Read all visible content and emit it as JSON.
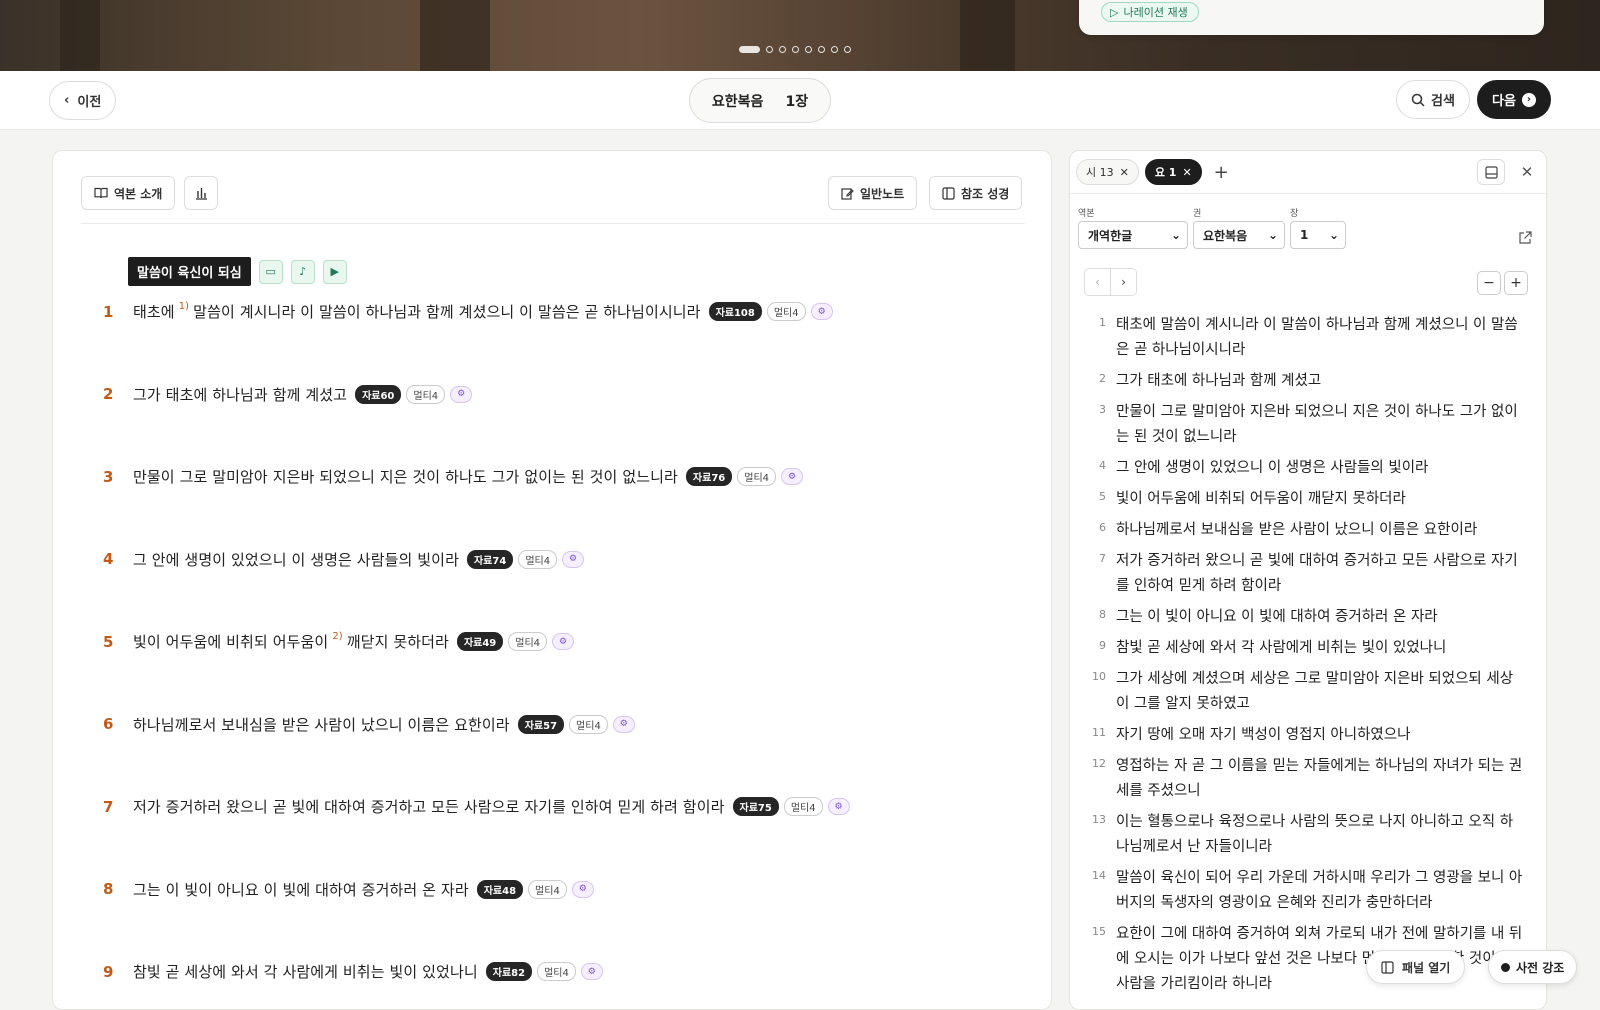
{
  "hero": {
    "narration_label": "나레이션 재생",
    "slides_total": 8,
    "slide_active": 1
  },
  "topbar": {
    "prev_label": "이전",
    "book": "요한복음",
    "chapter": "1장",
    "search_label": "검색",
    "next_label": "다음"
  },
  "toolbar": {
    "intro_label": "역본 소개",
    "note_label": "일반노트",
    "ref_label": "참조 성경"
  },
  "section": {
    "title": "말씀이 육신이 되심"
  },
  "verses": [
    {
      "num": "1",
      "pre": "태초에",
      "sup": "1)",
      "text": "말씀이 계시니라 이 말씀이 하나님과 함께 계셨으니 이 말씀은 곧 하나님이시니라",
      "tag": "자료108",
      "multi": "멀티4"
    },
    {
      "num": "2",
      "pre": "",
      "sup": "",
      "text": "그가 태초에 하나님과 함께 계셨고",
      "tag": "자료60",
      "multi": "멀티4"
    },
    {
      "num": "3",
      "pre": "",
      "sup": "",
      "text": "만물이 그로 말미암아 지은바 되었으니 지은 것이 하나도 그가 없이는 된 것이 없느니라",
      "tag": "자료76",
      "multi": "멀티4"
    },
    {
      "num": "4",
      "pre": "",
      "sup": "",
      "text": "그 안에 생명이 있었으니 이 생명은 사람들의 빛이라",
      "tag": "자료74",
      "multi": "멀티4"
    },
    {
      "num": "5",
      "pre": "빛이 어두움에 비취되 어두움이",
      "sup": "2)",
      "text": "깨닫지 못하더라",
      "tag": "자료49",
      "multi": "멀티4"
    },
    {
      "num": "6",
      "pre": "",
      "sup": "",
      "text": "하나님께로서 보내심을 받은 사람이 났으니 이름은 요한이라",
      "tag": "자료57",
      "multi": "멀티4"
    },
    {
      "num": "7",
      "pre": "",
      "sup": "",
      "text": "저가 증거하러 왔으니 곧 빛에 대하여 증거하고 모든 사람으로 자기를 인하여 믿게 하려 함이라",
      "tag": "자료75",
      "multi": "멀티4"
    },
    {
      "num": "8",
      "pre": "",
      "sup": "",
      "text": "그는 이 빛이 아니요 이 빛에 대하여 증거하러 온 자라",
      "tag": "자료48",
      "multi": "멀티4"
    },
    {
      "num": "9",
      "pre": "",
      "sup": "",
      "text": "참빛 곧 세상에 와서 각 사람에게 비취는 빛이 있었나니",
      "tag": "자료82",
      "multi": "멀티4"
    }
  ],
  "side": {
    "tabs": [
      {
        "label": "시 13"
      },
      {
        "label": "요 1"
      }
    ],
    "field_version_label": "역본",
    "field_book_label": "권",
    "field_chapter_label": "장",
    "version": "개역한글",
    "book": "요한복음",
    "chapter": "1",
    "verses": [
      {
        "n": "1",
        "t": "태초에 말씀이 계시니라 이 말씀이 하나님과 함께 계셨으니 이 말씀은 곧 하나님이시니라"
      },
      {
        "n": "2",
        "t": "그가 태초에 하나님과 함께 계셨고"
      },
      {
        "n": "3",
        "t": "만물이 그로 말미암아 지은바 되었으니 지은 것이 하나도 그가 없이는 된 것이 없느니라"
      },
      {
        "n": "4",
        "t": "그 안에 생명이 있었으니 이 생명은 사람들의 빛이라"
      },
      {
        "n": "5",
        "t": "빛이 어두움에 비취되 어두움이 깨닫지 못하더라"
      },
      {
        "n": "6",
        "t": "하나님께로서 보내심을 받은 사람이 났으니 이름은 요한이라"
      },
      {
        "n": "7",
        "t": "저가 증거하러 왔으니 곧 빛에 대하여 증거하고 모든 사람으로 자기를 인하여 믿게 하려 함이라"
      },
      {
        "n": "8",
        "t": "그는 이 빛이 아니요 이 빛에 대하여 증거하러 온 자라"
      },
      {
        "n": "9",
        "t": "참빛 곧 세상에 와서 각 사람에게 비취는 빛이 있었나니"
      },
      {
        "n": "10",
        "t": "그가 세상에 계셨으며 세상은 그로 말미암아 지은바 되었으되 세상이 그를 알지 못하였고"
      },
      {
        "n": "11",
        "t": "자기 땅에 오매 자기 백성이 영접지 아니하였으나"
      },
      {
        "n": "12",
        "t": "영접하는 자 곧 그 이름을 믿는 자들에게는 하나님의 자녀가 되는 권세를 주셨으니"
      },
      {
        "n": "13",
        "t": "이는 혈통으로나 육정으로나 사람의 뜻으로 나지 아니하고 오직 하나님께로서 난 자들이니라"
      },
      {
        "n": "14",
        "t": "말씀이 육신이 되어 우리 가운데 거하시매 우리가 그 영광을 보니 아버지의 독생자의 영광이요 은혜와 진리가 충만하더라"
      },
      {
        "n": "15",
        "t": "요한이 그에 대하여 증거하여 외쳐 가로되 내가 전에 말하기를 내 뒤에 오시는 이가 나보다 앞선 것은 나보다 먼저 계심이라 한 것이 이 사람을 가리킴이라 하니라"
      }
    ]
  },
  "floating": {
    "panel_label": "패널 열기",
    "dict_label": "사전 강조"
  },
  "colors": {
    "verse_number": "#c25b16",
    "dark": "#1d1d1d",
    "accent_green": "#1f7a5a",
    "accent_purple": "#7b4fd6"
  }
}
